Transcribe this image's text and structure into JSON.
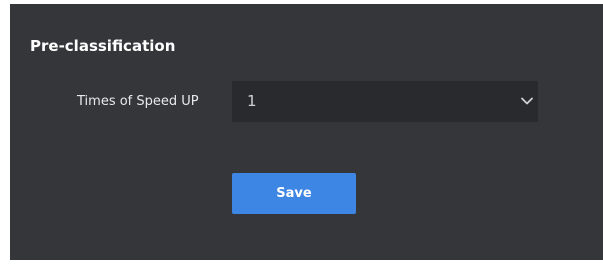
{
  "section": {
    "title": "Pre-classification"
  },
  "speed_up": {
    "label": "Times of Speed UP",
    "selected_value": "1",
    "dropdown_icon": "chevron-down-icon"
  },
  "actions": {
    "save_label": "Save"
  },
  "colors": {
    "panel_background": "#34363a",
    "select_background": "#282a2d",
    "primary_button": "#3e86e3",
    "title_text": "#ffffff"
  }
}
